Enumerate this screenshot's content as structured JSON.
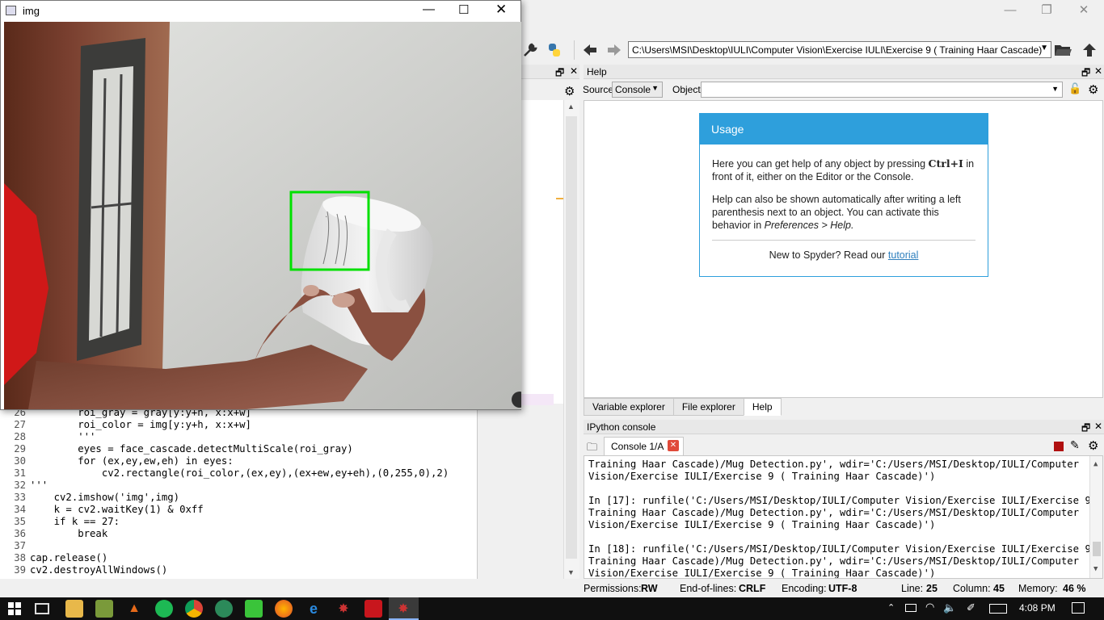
{
  "img_window": {
    "title": "img",
    "controls": [
      "—",
      "☐",
      "✕"
    ]
  },
  "spyder": {
    "window_controls": [
      "—",
      "❐",
      "✕"
    ],
    "path": "C:\\Users\\MSI\\Desktop\\IULI\\Computer Vision\\Exercise IULI\\Exercise 9 ( Training Haar Cascade)"
  },
  "help": {
    "title": "Help",
    "source_label": "Source",
    "source_value": "Console",
    "object_label": "Object",
    "object_value": "",
    "usage_title": "Usage",
    "p1_a": "Here you can get help of any object by pressing ",
    "p1_b": "Ctrl+I",
    "p1_c": " in front of it, either on the Editor or the Console.",
    "p2_a": "Help can also be shown automatically after writing a left parenthesis next to an object. You can activate this behavior in ",
    "p2_b": "Preferences > Help.",
    "p3_a": "New to Spyder? Read our ",
    "p3_link": "tutorial",
    "tabs": [
      "Variable explorer",
      "File explorer",
      "Help"
    ]
  },
  "console": {
    "title": "IPython console",
    "tab": "Console 1/A",
    "lines": [
      "Training Haar Cascade)/Mug Detection.py', wdir='C:/Users/MSI/Desktop/IULI/Computer",
      "Vision/Exercise IULI/Exercise 9 ( Training Haar Cascade)')",
      "",
      "In [17]: runfile('C:/Users/MSI/Desktop/IULI/Computer Vision/Exercise IULI/Exercise 9 (",
      "Training Haar Cascade)/Mug Detection.py', wdir='C:/Users/MSI/Desktop/IULI/Computer",
      "Vision/Exercise IULI/Exercise 9 ( Training Haar Cascade)')",
      "",
      "In [18]: runfile('C:/Users/MSI/Desktop/IULI/Computer Vision/Exercise IULI/Exercise 9 (",
      "Training Haar Cascade)/Mug Detection.py', wdir='C:/Users/MSI/Desktop/IULI/Computer",
      "Vision/Exercise IULI/Exercise 9 ( Training Haar Cascade)')"
    ]
  },
  "editor": {
    "lines": [
      {
        "n": "26",
        "code": "        roi_gray = gray[y:y+h, x:x+w]"
      },
      {
        "n": "27",
        "code": "        roi_color = img[y:y+h, x:x+w]"
      },
      {
        "n": "28",
        "code": "        '''"
      },
      {
        "n": "29",
        "code": "        eyes = face_cascade.detectMultiScale(roi_gray)"
      },
      {
        "n": "30",
        "code": "        for (ex,ey,ew,eh) in eyes:"
      },
      {
        "n": "31",
        "code": "            cv2.rectangle(roi_color,(ex,ey),(ex+ew,ey+eh),(0,255,0),2)"
      },
      {
        "n": "32",
        "code": "'''"
      },
      {
        "n": "33",
        "code": "    cv2.imshow('img',img)"
      },
      {
        "n": "34",
        "code": "    k = cv2.waitKey(1) & 0xff"
      },
      {
        "n": "35",
        "code": "    if k == 27:"
      },
      {
        "n": "36",
        "code": "        break"
      },
      {
        "n": "37",
        "code": ""
      },
      {
        "n": "38",
        "code": "cap.release()"
      },
      {
        "n": "39",
        "code": "cv2.destroyAllWindows()"
      }
    ]
  },
  "status": {
    "permissions_label": "Permissions:",
    "permissions": "RW",
    "eol_label": "End-of-lines:",
    "eol": "CRLF",
    "encoding_label": "Encoding:",
    "encoding": "UTF-8",
    "line_label": "Line:",
    "line": "25",
    "column_label": "Column:",
    "column": "45",
    "memory_label": "Memory:",
    "memory": "46 %"
  },
  "taskbar": {
    "clock": "4:08 PM"
  },
  "colors": {
    "accent": "#2e9fdc",
    "detection_box": "#00e000"
  }
}
